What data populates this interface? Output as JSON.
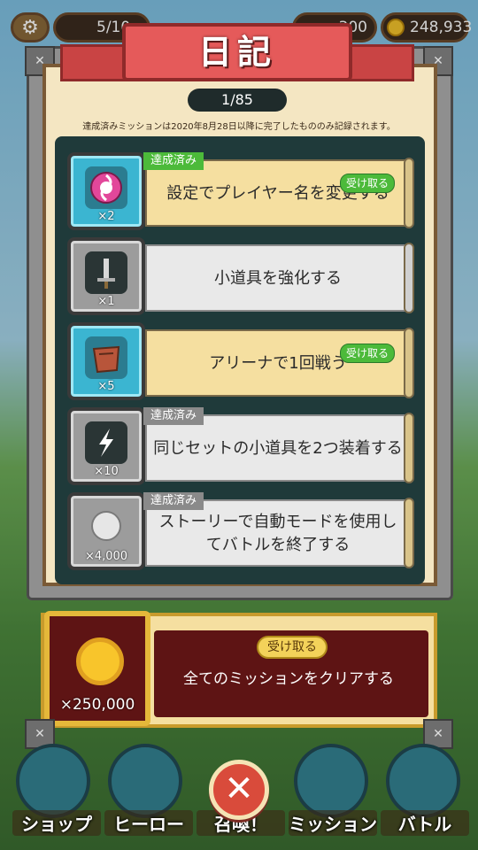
{
  "hud": {
    "stamina": "5/10",
    "gems": "300",
    "coins": "248,933"
  },
  "dialog": {
    "title": "日記",
    "page": "1/85",
    "notice": "達成済みミッションは2020年8月28日以降に完了したもののみ記録されます。"
  },
  "missions": [
    {
      "text": "設定でプレイヤー名を変更する",
      "qty": "×2",
      "tag": "達成済み",
      "claim": "受け取る",
      "style": "yellow",
      "icon": "pink-swirl-icon"
    },
    {
      "text": "小道具を強化する",
      "qty": "×1",
      "tag": "",
      "claim": "",
      "style": "white",
      "icon": "sword-icon"
    },
    {
      "text": "アリーナで1回戦う",
      "qty": "×5",
      "tag": "",
      "claim": "受け取る",
      "style": "yellow",
      "icon": "leather-bag-icon"
    },
    {
      "text": "同じセットの小道具を2つ装着する",
      "qty": "×10",
      "tag": "達成済み",
      "claim": "",
      "style": "white",
      "icon": "lightning-icon"
    },
    {
      "text": "ストーリーで自動モードを使用してバトルを終了する",
      "qty": "×4,000",
      "tag": "達成済み",
      "claim": "",
      "style": "white",
      "icon": "silver-coin-icon"
    }
  ],
  "reward": {
    "qty": "×250,000",
    "claim": "受け取る",
    "text": "全てのミッションをクリアする"
  },
  "nav": {
    "shop": "ショップ",
    "hero": "ヒーロー",
    "summon": "召喚！",
    "mission": "ミッション",
    "battle": "バトル"
  },
  "colors": {
    "ribbon": "#e55a5a",
    "claim_green": "#4cba3a",
    "reward_bg": "#5e1414",
    "gold": "#f8c52b"
  }
}
